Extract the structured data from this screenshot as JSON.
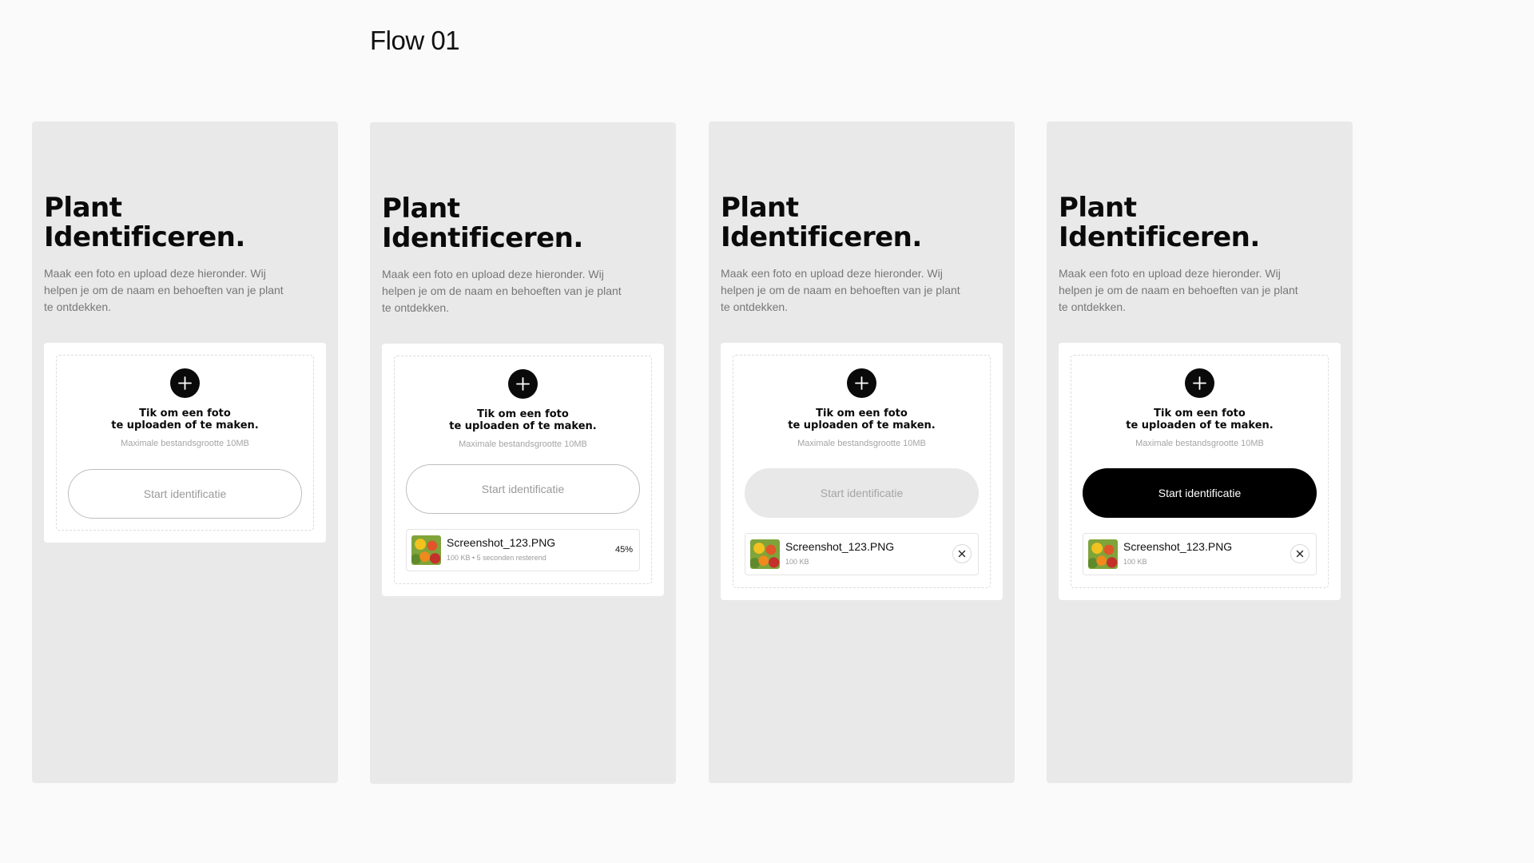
{
  "flow_title": "Flow 01",
  "colors": {
    "screen_bg": "#e9e9e9",
    "accent": "#000000",
    "page_bg": "#fafafa"
  },
  "screens": [
    {
      "heading_line1": "Plant",
      "heading_line2": "Identificeren.",
      "description": "Maak een foto en upload deze hieronder. Wij helpen je om de naam en behoeften van je plant te ontdekken.",
      "tap_line1": "Tik om een foto",
      "tap_line2": "te uploaden of te maken.",
      "max_size": "Maximale bestandsgrootte 10MB",
      "start_button": "Start identificatie",
      "button_state": "outline",
      "add_icon": "plus-icon"
    },
    {
      "heading_line1": "Plant",
      "heading_line2": "Identificeren.",
      "description": "Maak een foto en upload deze hieronder. Wij helpen je om de naam en behoeften van je plant te ontdekken.",
      "tap_line1": "Tik om een foto",
      "tap_line2": "te uploaden of te maken.",
      "max_size": "Maximale bestandsgrootte 10MB",
      "start_button": "Start identificatie",
      "button_state": "outline",
      "add_icon": "plus-icon",
      "file": {
        "name": "Screenshot_123.PNG",
        "meta": "100 KB • 5 seconden resterend",
        "progress": "45%"
      }
    },
    {
      "heading_line1": "Plant",
      "heading_line2": "Identificeren.",
      "description": "Maak een foto en upload deze hieronder. Wij helpen je om de naam en behoeften van je plant te ontdekken.",
      "tap_line1": "Tik om een foto",
      "tap_line2": "te uploaden of te maken.",
      "max_size": "Maximale bestandsgrootte 10MB",
      "start_button": "Start identificatie",
      "button_state": "disabled",
      "add_icon": "plus-icon",
      "file": {
        "name": "Screenshot_123.PNG",
        "meta": "100 KB",
        "remove_icon": "close-icon"
      }
    },
    {
      "heading_line1": "Plant",
      "heading_line2": "Identificeren.",
      "description": "Maak een foto en upload deze hieronder. Wij helpen je om de naam en behoeften van je plant te ontdekken.",
      "tap_line1": "Tik om een foto",
      "tap_line2": "te uploaden of te maken.",
      "max_size": "Maximale bestandsgrootte 10MB",
      "start_button": "Start identificatie",
      "button_state": "active",
      "add_icon": "plus-icon",
      "file": {
        "name": "Screenshot_123.PNG",
        "meta": "100 KB",
        "remove_icon": "close-icon"
      }
    }
  ]
}
